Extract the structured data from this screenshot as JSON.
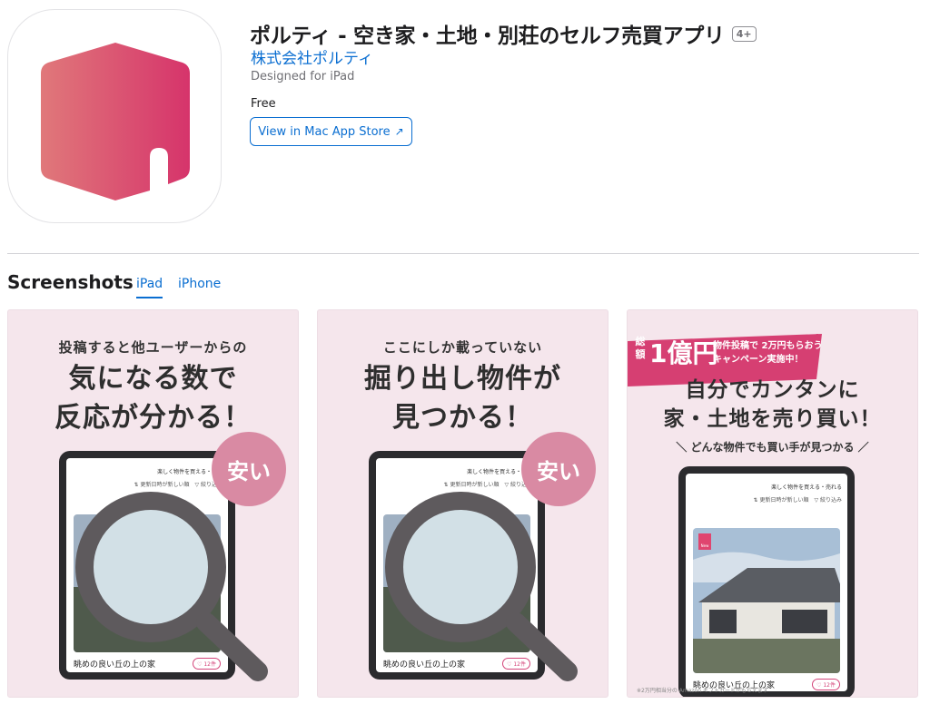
{
  "app": {
    "title": "ポルティ - 空き家・土地・別荘のセルフ売買アプリ",
    "age_rating": "4+",
    "developer": "株式会社ポルティ",
    "designed_for": "Designed for iPad",
    "price": "Free",
    "store_button": "View in Mac App Store",
    "store_button_icon": "↗",
    "icon_gradient": [
      "#e0787a",
      "#d6346b"
    ]
  },
  "screenshots_section": {
    "title": "Screenshots",
    "tabs": [
      {
        "label": "iPad",
        "active": true
      },
      {
        "label": "iPhone",
        "active": false
      }
    ]
  },
  "screenshots": [
    {
      "caption_small": "投稿すると他ユーザーからの",
      "caption_big_1": "気になる数で",
      "caption_big_2": "反応が分かる！",
      "bubble": "安い",
      "screen_header": "楽しく物件を買える・売れ",
      "screen_sort": "⇅ 更新日時が新しい順　▽ 絞り込み",
      "listing_title": "眺めの良い丘の上の家",
      "listing_count": "♡ 12件"
    },
    {
      "caption_small": "ここにしか載っていない",
      "caption_big_1": "掘り出し物件が",
      "caption_big_2": "見つかる！",
      "bubble": "安い",
      "screen_header": "楽しく物件を買える・売れ",
      "screen_sort": "⇅ 更新日時が新しい順　▽ 絞り込み",
      "listing_title": "眺めの良い丘の上の家",
      "listing_count": "♡ 12件"
    },
    {
      "banner_total": "総額",
      "banner_amount": "1億円",
      "banner_line1": "物件投稿で 2万円もらおう",
      "banner_line2": "キャンペーン実施中！",
      "caption_big_1": "自分でカンタンに",
      "caption_big_2": "家・土地を売り買い！",
      "caption_sub": "＼ どんな物件でも買い手が見つかる ／",
      "screen_header": "楽しく物件を買える・売れる",
      "screen_sort": "⇅ 更新日時が新しい順　▽ 絞り込み",
      "new_tag": "New",
      "listing_title": "眺めの良い丘の上の家",
      "listing_count": "♡ 12件",
      "footnote": "※2万円相当分の Amazon ギフトカードがもらえます"
    }
  ]
}
